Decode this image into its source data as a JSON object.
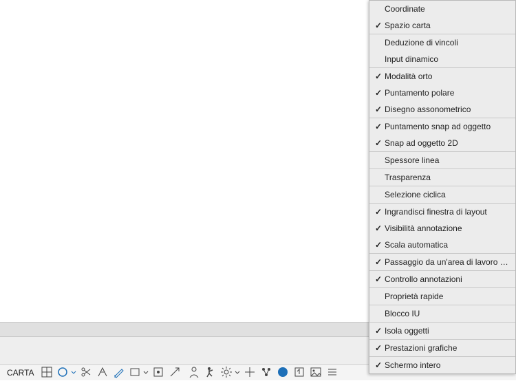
{
  "statusbar": {
    "space_label": "CARTA",
    "icons": [
      {
        "name": "grid-icon",
        "glyph": "grid",
        "dropdown": false
      },
      {
        "name": "circle-icon",
        "glyph": "circle",
        "dropdown": true,
        "blue": true
      },
      {
        "name": "scissors-icon",
        "glyph": "scissors",
        "dropdown": false
      },
      {
        "name": "constraint-icon",
        "glyph": "constraint",
        "dropdown": false
      },
      {
        "name": "draw-icon",
        "glyph": "pencil",
        "dropdown": false,
        "blue": true
      },
      {
        "name": "rect-icon",
        "glyph": "rect",
        "dropdown": true
      },
      {
        "name": "snap-icon",
        "glyph": "snap",
        "dropdown": false
      },
      {
        "name": "scale-icon",
        "glyph": "scale",
        "dropdown": false
      },
      {
        "sep": true
      },
      {
        "name": "person-icon",
        "glyph": "person",
        "dropdown": false
      },
      {
        "name": "person-run-icon",
        "glyph": "personrun",
        "dropdown": false
      },
      {
        "name": "gear-icon",
        "glyph": "gear",
        "dropdown": true
      },
      {
        "name": "crosshair-icon",
        "glyph": "plus",
        "dropdown": false
      },
      {
        "name": "node-icon",
        "glyph": "node",
        "dropdown": false
      },
      {
        "name": "globe-icon",
        "glyph": "globefill",
        "dropdown": false,
        "blue": true
      },
      {
        "name": "export-icon",
        "glyph": "export",
        "dropdown": false
      },
      {
        "name": "image-icon",
        "glyph": "image",
        "dropdown": false
      },
      {
        "name": "customize-icon",
        "glyph": "customize",
        "dropdown": false
      }
    ]
  },
  "menu": {
    "items": [
      {
        "label": "Coordinate",
        "checked": false
      },
      {
        "label": "Spazio carta",
        "checked": true
      },
      {
        "sep": true
      },
      {
        "label": "Deduzione di vincoli",
        "checked": false
      },
      {
        "label": "Input dinamico",
        "checked": false
      },
      {
        "sep": true
      },
      {
        "label": "Modalità orto",
        "checked": true
      },
      {
        "label": "Puntamento polare",
        "checked": true
      },
      {
        "label": "Disegno assonometrico",
        "checked": true
      },
      {
        "sep": true
      },
      {
        "label": "Puntamento snap ad oggetto",
        "checked": true
      },
      {
        "label": "Snap ad oggetto 2D",
        "checked": true
      },
      {
        "sep": true
      },
      {
        "label": "Spessore linea",
        "checked": false
      },
      {
        "sep": true
      },
      {
        "label": "Trasparenza",
        "checked": false
      },
      {
        "sep": true
      },
      {
        "label": "Selezione ciclica",
        "checked": false
      },
      {
        "sep": true
      },
      {
        "label": "Ingrandisci finestra di layout",
        "checked": true
      },
      {
        "label": "Visibilità annotazione",
        "checked": true
      },
      {
        "label": "Scala automatica",
        "checked": true
      },
      {
        "sep": true
      },
      {
        "label": "Passaggio da un'area di lavoro ad un'altra",
        "checked": true
      },
      {
        "sep": true
      },
      {
        "label": "Controllo annotazioni",
        "checked": true
      },
      {
        "sep": true
      },
      {
        "label": "Proprietà rapide",
        "checked": false
      },
      {
        "sep": true
      },
      {
        "label": "Blocco IU",
        "checked": false
      },
      {
        "sep": true
      },
      {
        "label": "Isola oggetti",
        "checked": true
      },
      {
        "sep": true
      },
      {
        "label": "Prestazioni grafiche",
        "checked": true
      },
      {
        "sep": true
      },
      {
        "label": "Schermo intero",
        "checked": true
      }
    ]
  }
}
